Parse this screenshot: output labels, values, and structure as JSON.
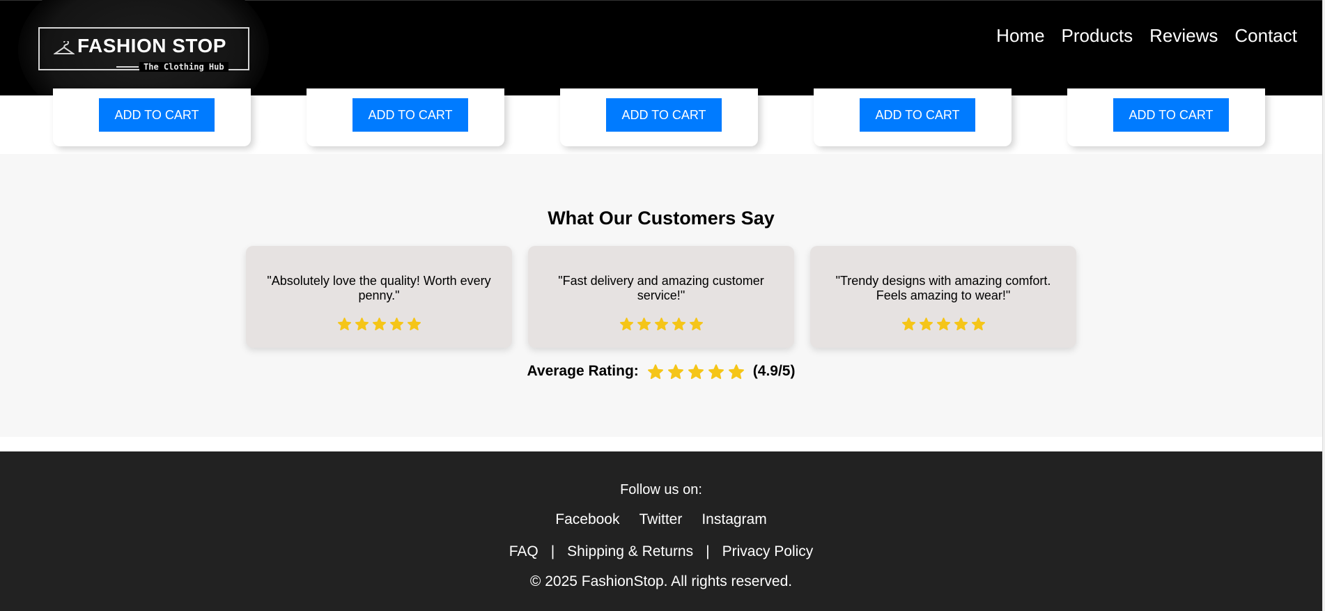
{
  "header": {
    "brand": "FASHION STOP",
    "tagline": "The Clothing Hub",
    "logo_icon": "hanger-icon",
    "nav": [
      {
        "label": "Home"
      },
      {
        "label": "Products"
      },
      {
        "label": "Reviews"
      },
      {
        "label": "Contact"
      }
    ]
  },
  "products": {
    "buttons": [
      "ADD TO CART",
      "ADD TO CART",
      "ADD TO CART",
      "ADD TO CART",
      "ADD TO CART"
    ]
  },
  "reviews": {
    "title": "What Our Customers Say",
    "items": [
      {
        "text": "\"Absolutely love the quality! Worth every penny.\"",
        "stars": 5
      },
      {
        "text": "\"Fast delivery and amazing customer service!\"",
        "stars": 5
      },
      {
        "text": "\"Trendy designs with amazing comfort. Feels amazing to wear!\"",
        "stars": 5
      }
    ],
    "average_label": "Average Rating:",
    "average_stars": 5,
    "average_value": "(4.9/5)",
    "star_color": "#f5c518"
  },
  "footer": {
    "follow_label": "Follow us on:",
    "social": [
      "Facebook",
      "Twitter",
      "Instagram"
    ],
    "links": [
      "FAQ",
      "|",
      "Shipping & Returns",
      "|",
      "Privacy Policy"
    ],
    "copyright": "© 2025 FashionStop. All rights reserved."
  },
  "colors": {
    "accent": "#007bff",
    "header_bg": "#000000",
    "footer_bg": "#222222",
    "reviews_bg": "#f7f7f7",
    "card_bg": "#e6e2e1"
  }
}
